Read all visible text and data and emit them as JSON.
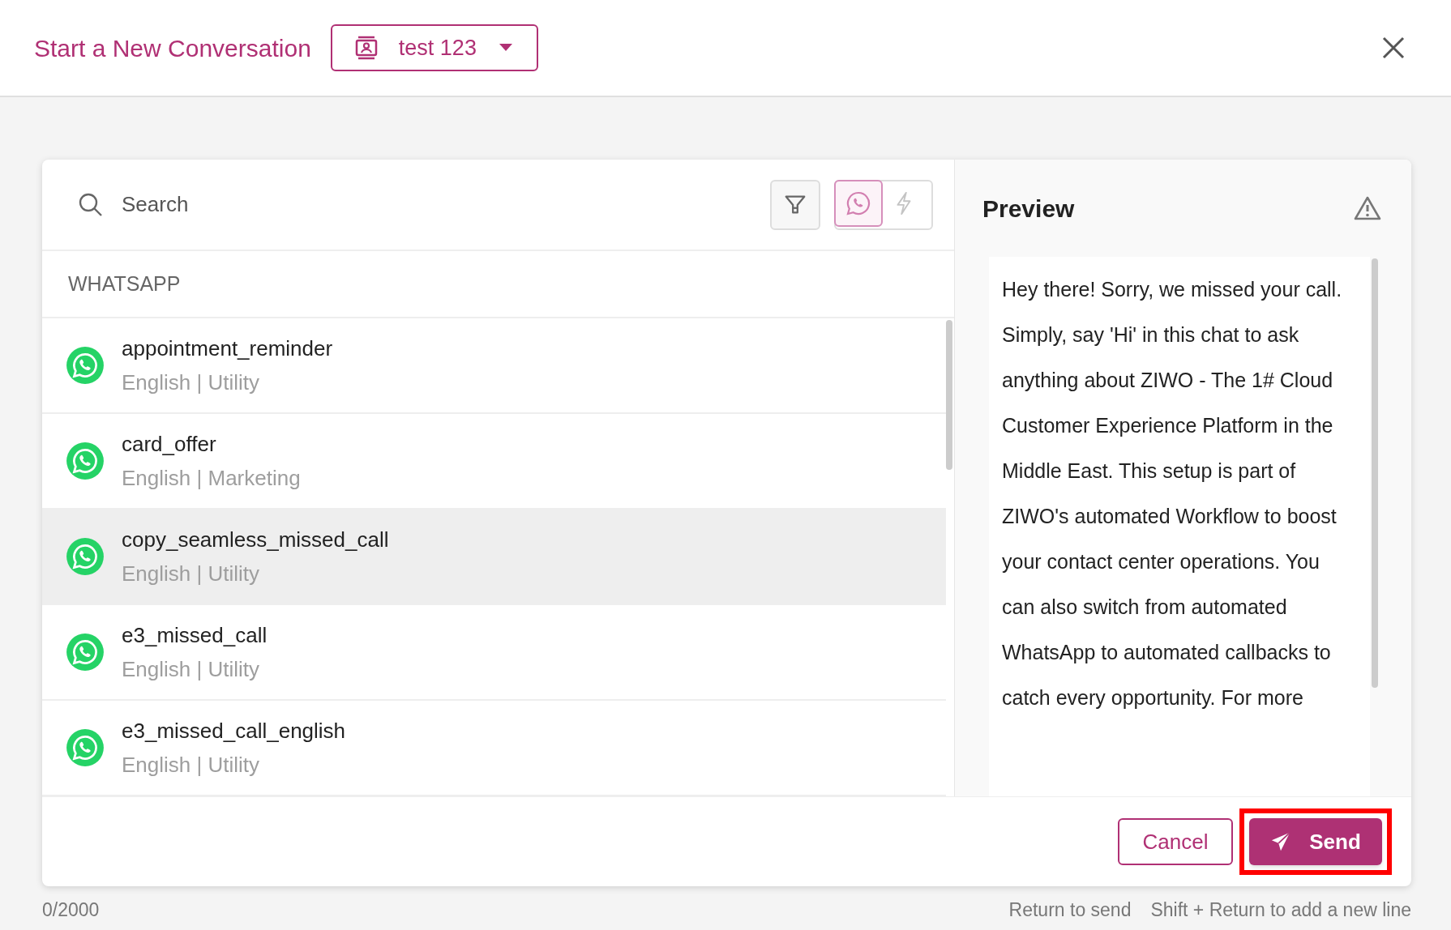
{
  "header": {
    "title": "Start a New Conversation",
    "contact_select": {
      "value": "test 123"
    }
  },
  "search": {
    "placeholder": "Search"
  },
  "channel_filters": [
    {
      "kind": "whatsapp",
      "selected": true
    },
    {
      "kind": "automation",
      "selected": false
    }
  ],
  "template_group": "WHATSAPP",
  "templates": [
    {
      "name": "appointment_reminder",
      "meta": "English | Utility",
      "selected": false
    },
    {
      "name": "card_offer",
      "meta": "English | Marketing",
      "selected": false
    },
    {
      "name": "copy_seamless_missed_call",
      "meta": "English | Utility",
      "selected": true
    },
    {
      "name": "e3_missed_call",
      "meta": "English | Utility",
      "selected": false
    },
    {
      "name": "e3_missed_call_english",
      "meta": "English | Utility",
      "selected": false
    }
  ],
  "preview": {
    "title": "Preview",
    "text": "Hey there! Sorry, we missed your call. Simply, say 'Hi' in this chat to ask anything about ZIWO - The 1# Cloud Customer Experience Platform in the Middle East. This setup is part of ZIWO's automated Workflow to boost your contact center operations. You can also switch from automated WhatsApp to automated callbacks to catch every opportunity. For more"
  },
  "actions": {
    "cancel": "Cancel",
    "send": "Send"
  },
  "footer": {
    "counter": "0/2000",
    "hints": [
      "Return to send",
      "Shift + Return to add a new line"
    ]
  }
}
